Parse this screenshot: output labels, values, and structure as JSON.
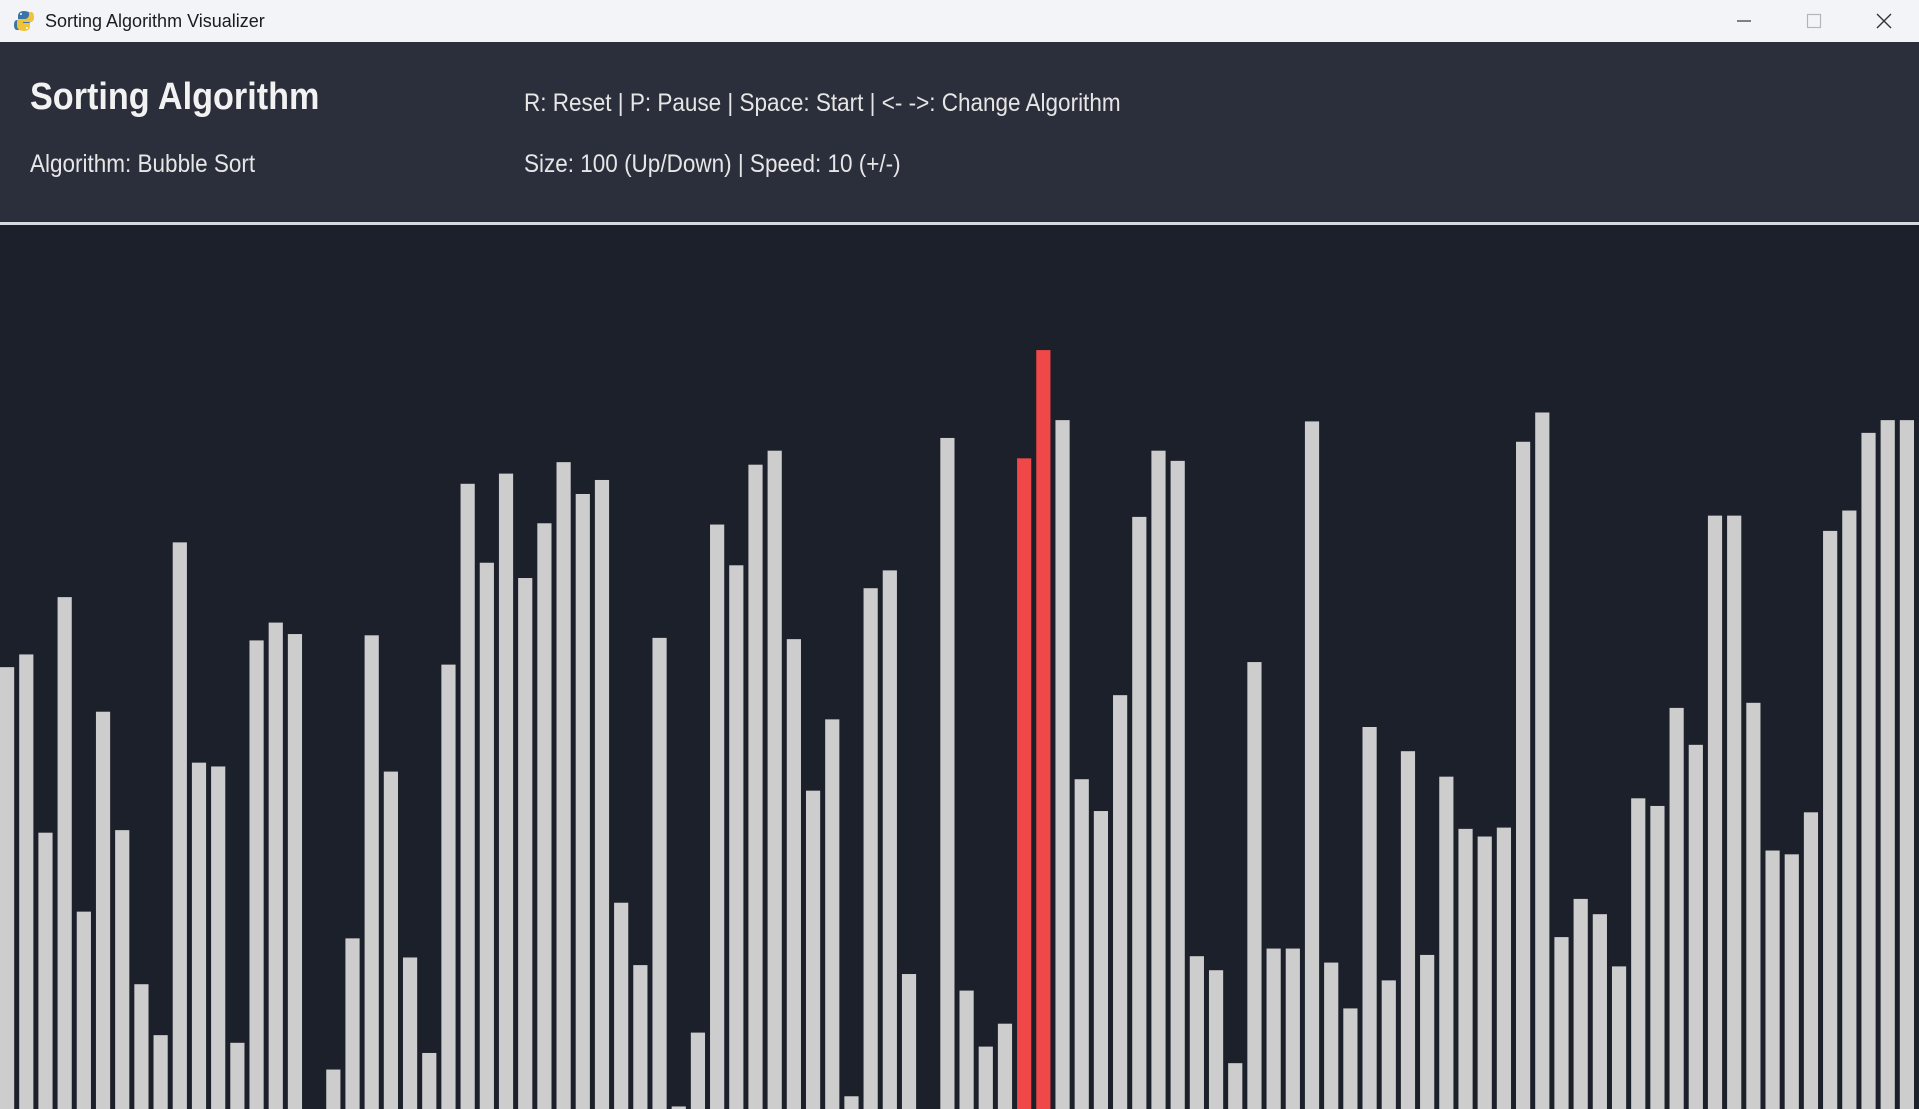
{
  "window": {
    "title": "Sorting Algorithm Visualizer",
    "app_icon": "python-snake-icon",
    "controls": [
      "minimize-icon",
      "maximize-icon",
      "close-icon"
    ]
  },
  "header": {
    "title": "Sorting Algorithm",
    "algorithm_text": "Algorithm: Bubble Sort",
    "controls_text": "R: Reset | P: Pause | Space: Start | <- ->: Change Algorithm",
    "settings_text": "Size: 100 (Up/Down) | Speed: 10 (+/-)"
  },
  "colors": {
    "bar": "#cdcdcd",
    "highlight": "#f04848",
    "background": "#1c202a",
    "header": "#2b2f3b"
  },
  "chart_data": {
    "type": "bar",
    "y_max": 600,
    "highlighted_indices": [
      53,
      54
    ],
    "values": [
      347,
      357,
      217,
      402,
      155,
      312,
      219,
      98,
      58,
      445,
      272,
      269,
      52,
      368,
      382,
      373,
      0,
      31,
      134,
      372,
      265,
      119,
      44,
      349,
      491,
      429,
      499,
      417,
      460,
      508,
      483,
      494,
      162,
      113,
      370,
      2,
      60,
      459,
      427,
      506,
      517,
      369,
      250,
      306,
      10,
      409,
      423,
      106,
      0,
      527,
      93,
      49,
      67,
      511,
      596,
      541,
      259,
      234,
      325,
      465,
      517,
      509,
      120,
      109,
      36,
      351,
      126,
      126,
      540,
      115,
      79,
      300,
      101,
      281,
      121,
      261,
      220,
      214,
      221,
      524,
      547,
      135,
      165,
      153,
      112,
      244,
      238,
      315,
      286,
      466,
      466,
      319,
      203,
      200,
      233,
      454,
      470,
      531,
      541,
      541
    ]
  }
}
